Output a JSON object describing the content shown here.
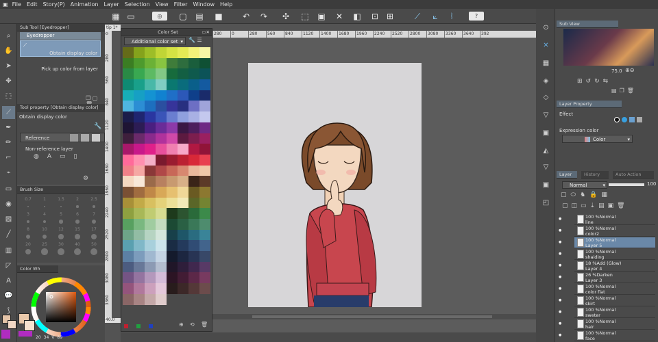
{
  "menu": [
    "File",
    "Edit",
    "Story(P)",
    "Animation",
    "Layer",
    "Selection",
    "View",
    "Filter",
    "Window",
    "Help"
  ],
  "subtool": {
    "header": "Sub Tool [Eyedropper]",
    "active": "Eyedropper",
    "items": [
      "Obtain display color",
      "Pick up color from layer"
    ]
  },
  "toolprop": {
    "header": "Tool property [Obtain display color]",
    "title": "Obtain display color",
    "reference": "Reference",
    "nonref": "Non-reference layer"
  },
  "brushsize": {
    "header": "Brush Size",
    "values": [
      "0.7",
      "1",
      "1.5",
      "2",
      "2.5",
      "3",
      "4",
      "5",
      "6",
      "7",
      "8",
      "10",
      "12",
      "15",
      "17",
      "20",
      "25",
      "30",
      "40",
      "50"
    ]
  },
  "colorwheel": {
    "header": "Color Wh",
    "readout": [
      "20",
      "34",
      "V",
      "89"
    ]
  },
  "colorset": {
    "header": "Color Set",
    "dropdown": "Additional color set"
  },
  "ruler": {
    "labels": [
      "280",
      "0",
      "280",
      "560",
      "840",
      "1120",
      "1400",
      "1680",
      "1960",
      "2240",
      "2520",
      "2800",
      "3080",
      "3360",
      "3640",
      "392"
    ],
    "vlabels": [
      "0",
      "280",
      "560",
      "840",
      "1120",
      "1400",
      "1680",
      "1960",
      "2240",
      "2520",
      "2800",
      "3080",
      "3360"
    ],
    "tab": "tip 1*"
  },
  "zoom": "40.0",
  "subview": {
    "header": "Sub View",
    "zoom": "75.0"
  },
  "layerprop": {
    "header": "Layer Property",
    "effect": "Effect",
    "expr": "Expression color",
    "color": "Color"
  },
  "layerpanel": {
    "tabs": [
      "Layer",
      "History",
      "Auto Action"
    ],
    "blend": "Normal",
    "opacity": "100"
  },
  "layers": [
    {
      "line1": "100 %Normal",
      "line2": "line"
    },
    {
      "line1": "100 %Normal",
      "line2": "color2"
    },
    {
      "line1": "100 %Normal",
      "line2": "Layer 5"
    },
    {
      "line1": "100 %Normal",
      "line2": "shaiding"
    },
    {
      "line1": "18 %Add (Glow)",
      "line2": "Layer 4"
    },
    {
      "line1": "26 %Darken",
      "line2": "Layer 3"
    },
    {
      "line1": "100 %Normal",
      "line2": "color flat"
    },
    {
      "line1": "100 %Normal",
      "line2": "skirt"
    },
    {
      "line1": "100 %Normal",
      "line2": "sweter"
    },
    {
      "line1": "100 %Normal",
      "line2": "hair"
    },
    {
      "line1": "100 %Normal",
      "line2": "face"
    }
  ],
  "palette": [
    "#656b19",
    "#85a21c",
    "#9dbd28",
    "#c0d536",
    "#d5e244",
    "#e4ea55",
    "#f2f27a",
    "#f7f6a6",
    "#3b7d23",
    "#4d9a2d",
    "#6bb136",
    "#88c441",
    "#3f7c3a",
    "#2e6d3e",
    "#1a5e3c",
    "#0f5034",
    "#2a8a45",
    "#39a851",
    "#5dba63",
    "#83c985",
    "#176b3c",
    "#135f43",
    "#0f5a4d",
    "#0c5358",
    "#0f8a73",
    "#19a08a",
    "#48b8a8",
    "#7fcdc3",
    "#0a7870",
    "#0a6c7c",
    "#0a5f8a",
    "#145aa0",
    "#18aeb8",
    "#16a0c4",
    "#1493d2",
    "#1182d0",
    "#1f6fc7",
    "#2c58b8",
    "#0f3f8a",
    "#1a2b6a",
    "#4fb5df",
    "#2c8ed4",
    "#1d6fbf",
    "#2a4fa0",
    "#36349a",
    "#283080",
    "#6d6fc4",
    "#a0a4da",
    "#1b1c4a",
    "#1f2570",
    "#2a36a0",
    "#3a54b8",
    "#6a7ed0",
    "#8fa0de",
    "#a8b0e4",
    "#c4c8ee",
    "#1e1434",
    "#2c1c54",
    "#4a1f80",
    "#6a2c98",
    "#8c3aa8",
    "#3a1844",
    "#4c1e5c",
    "#6e2a84",
    "#3e1f3c",
    "#6a2a6a",
    "#8a2a8c",
    "#b0329c",
    "#d049a8",
    "#5c1a40",
    "#7c1e4e",
    "#9a2060",
    "#a8186a",
    "#c8188a",
    "#e0208a",
    "#e8509c",
    "#f080b0",
    "#f7a8c8",
    "#b01842",
    "#901438",
    "#ff6a9a",
    "#ff90b0",
    "#f4b0c8",
    "#7a1a2e",
    "#9a1c30",
    "#bb2132",
    "#d82838",
    "#e84050",
    "#f08088",
    "#f5a8a4",
    "#8a3838",
    "#b04848",
    "#c86858",
    "#d88870",
    "#e9b89c",
    "#f0c8a8",
    "#f4d8c0",
    "#f8e8d8",
    "#9a6a4a",
    "#b88060",
    "#c89a70",
    "#d8b088",
    "#3a2418",
    "#5c3a28",
    "#7a5034",
    "#a06c40",
    "#c08848",
    "#d8a858",
    "#e6c070",
    "#f0d898",
    "#6a5a22",
    "#8c7830",
    "#a89038",
    "#c2aa48",
    "#d8c060",
    "#e4d27a",
    "#ece098",
    "#f2eab8",
    "#5a6628",
    "#748432",
    "#8ea040",
    "#a8b858",
    "#c0cc72",
    "#d6dc92",
    "#1e3a1c",
    "#2c5430",
    "#2a6a3a",
    "#3c8a4a",
    "#58a060",
    "#7ab880",
    "#a0cca0",
    "#c4dcc0",
    "#1c4a34",
    "#2a6044",
    "#3a7858",
    "#4e8c6e",
    "#6ea488",
    "#92bca4",
    "#b6d4c2",
    "#d4e6dc",
    "#18404a",
    "#1e5668",
    "#2a6c80",
    "#3a8498",
    "#5aa0b0",
    "#80b8c8",
    "#a8d0dc",
    "#cce4ec",
    "#1a2c44",
    "#243a5c",
    "#304c74",
    "#42648c",
    "#5c80a4",
    "#7c9cbc",
    "#a0b8d0",
    "#c4d4e4",
    "#141a2c",
    "#1c2640",
    "#283454",
    "#384868",
    "#4c5c80",
    "#687898",
    "#8c9ab4",
    "#b4bed0",
    "#201628",
    "#2e1e3a",
    "#40284e",
    "#583a66",
    "#745484",
    "#9474a0",
    "#b498bc",
    "#d4bcd8",
    "#2c1424",
    "#421c34",
    "#5c2848",
    "#783a60",
    "#94547c",
    "#b0789c",
    "#cca0bc",
    "#e4c8da",
    "#281c1c",
    "#3c2828",
    "#543838",
    "#6c4c4c",
    "#8a6666",
    "#a88484",
    "#c4a8a8",
    "#e0cccc"
  ]
}
